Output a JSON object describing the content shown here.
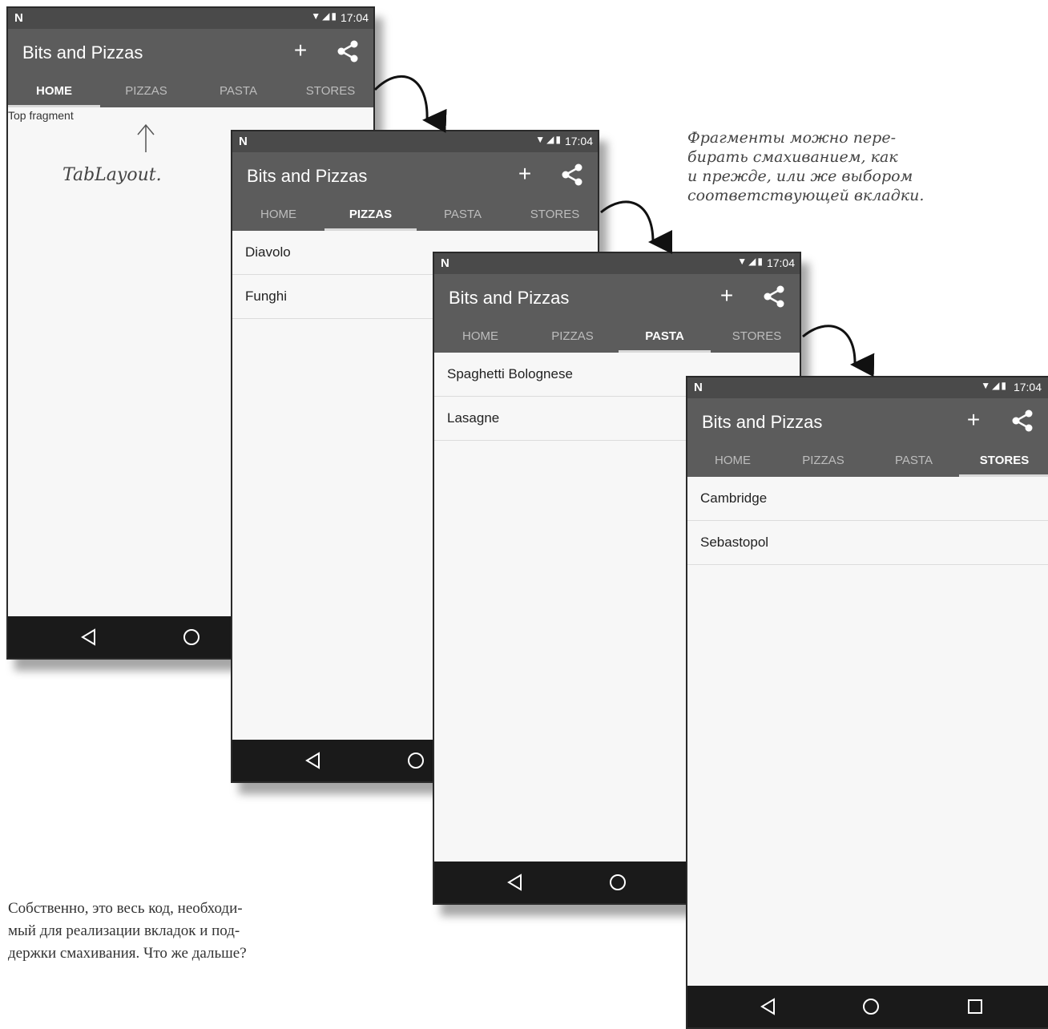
{
  "status": {
    "logo": "N",
    "icons": "▼◢▮",
    "time": "17:04"
  },
  "app": {
    "title": "Bits and Pizzas",
    "add_icon": "plus-icon",
    "share_icon": "share-icon"
  },
  "tabs": [
    "HOME",
    "PIZZAS",
    "PASTA",
    "STORES"
  ],
  "screens": {
    "home": {
      "active_tab": "HOME",
      "fragment_text": "Top fragment"
    },
    "pizzas": {
      "active_tab": "PIZZAS",
      "items": [
        "Diavolo",
        "Funghi"
      ]
    },
    "pasta": {
      "active_tab": "PASTA",
      "items": [
        "Spaghetti Bolognese",
        "Lasagne"
      ]
    },
    "stores": {
      "active_tab": "STORES",
      "items": [
        "Cambridge",
        "Sebastopol"
      ]
    }
  },
  "annotations": {
    "tablayout": "TabLayout.",
    "swipe_line1": "Фрагменты можно пере-",
    "swipe_line2": "бирать смахиванием, как",
    "swipe_line3": "и прежде, или же выбором",
    "swipe_line4": "соответствующей вкладки."
  },
  "body_text": {
    "line1": "Собственно, это весь код, необходи-",
    "line2": "мый для реализации вкладок и под-",
    "line3": "держки смахивания. Что же дальше?"
  },
  "colors": {
    "appbar": "#5c5c5c",
    "statusbar": "#4a4a4a",
    "navbar": "#1a1a1a",
    "content": "#f7f7f7"
  }
}
